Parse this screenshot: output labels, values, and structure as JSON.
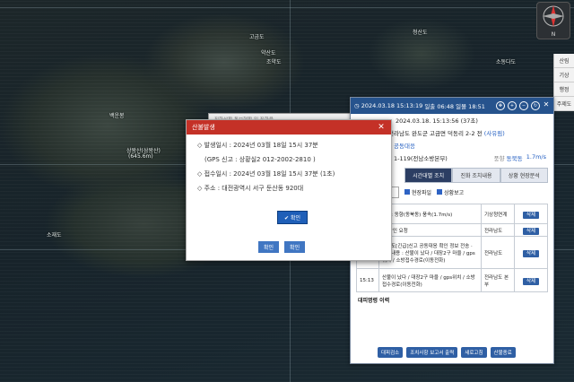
{
  "map": {
    "labels": [
      "상왕산(삼왕산)",
      "(645.6m)",
      "백운봉",
      "소재도",
      "소동다도",
      "고금도",
      "약산도",
      "조약도",
      "청산도"
    ],
    "compass_label": "N"
  },
  "right_toolbar": [
    "산림",
    "기상",
    "행정",
    "주제도"
  ],
  "panel": {
    "header_date": "2024.03.18 15:13:19",
    "header_sunrise": "일출 06:48",
    "header_sunset": "일몰 18:51",
    "report_time": "2024.03.18. 15:13:56 (37초)",
    "location": "전라남도 완도군 고금면 덕동리 2-2 전",
    "location_tag": "(사유림)",
    "category": "공동대응",
    "agency": "1-119(전남소방본부)",
    "wind_label": "풍향",
    "wind_dir": "동북동",
    "wind_speed": "1.7m/s",
    "tabs": [
      "시간대별 조치",
      "진화 조치내용",
      "상황 현장분석"
    ],
    "filter_select": "선택",
    "filter_checks": [
      "현장파일",
      "상황보고"
    ],
    "table": [
      {
        "time": "",
        "content": "풍속: 동향(동북동) 풍속(1.7m/s)",
        "org": "기상청연계",
        "action": "삭제"
      },
      {
        "time": "",
        "content": "군 확인 요청",
        "org": "전라남도",
        "action": "삭제"
      },
      {
        "time": "15:14",
        "content": "전남도[긴급]신고 공동대응 확인 정보 전송 · 전화내용 : 산불이 났다 / 대장2구 마을 / gps위치 / 소방접수경로(이동전화)",
        "org": "전라남도",
        "action": "삭제"
      },
      {
        "time": "15:13",
        "content": "산불이 났다 / 대장2구 마을 / gps위치 / 소방접수경로(이동전화)",
        "org": "전라남도 본부",
        "action": "삭제"
      }
    ],
    "section_title": "대피명령 이력",
    "bottom_buttons": [
      "대피검소",
      "조치사항 보고서 출력",
      "새로고침",
      "산불종료"
    ]
  },
  "fire_dialog": {
    "title": "산불발생",
    "line1": "◇ 발생일시 : 2024년 03월 18일 15시 37분",
    "line2": "(GPS 신고 : 상황실2 012-2002-2810 )",
    "line3": "◇ 접수일시 : 2024년 03월 18일 15시 37분 (1초)",
    "line4": "◇ 주소 : 대전광역시 서구 둔산동 920대",
    "confirm": "확인",
    "ghost_buttons": [
      "확인",
      "확인"
    ]
  },
  "back_dialog": {
    "title": "진화상황 통보현황 및 진화율"
  }
}
